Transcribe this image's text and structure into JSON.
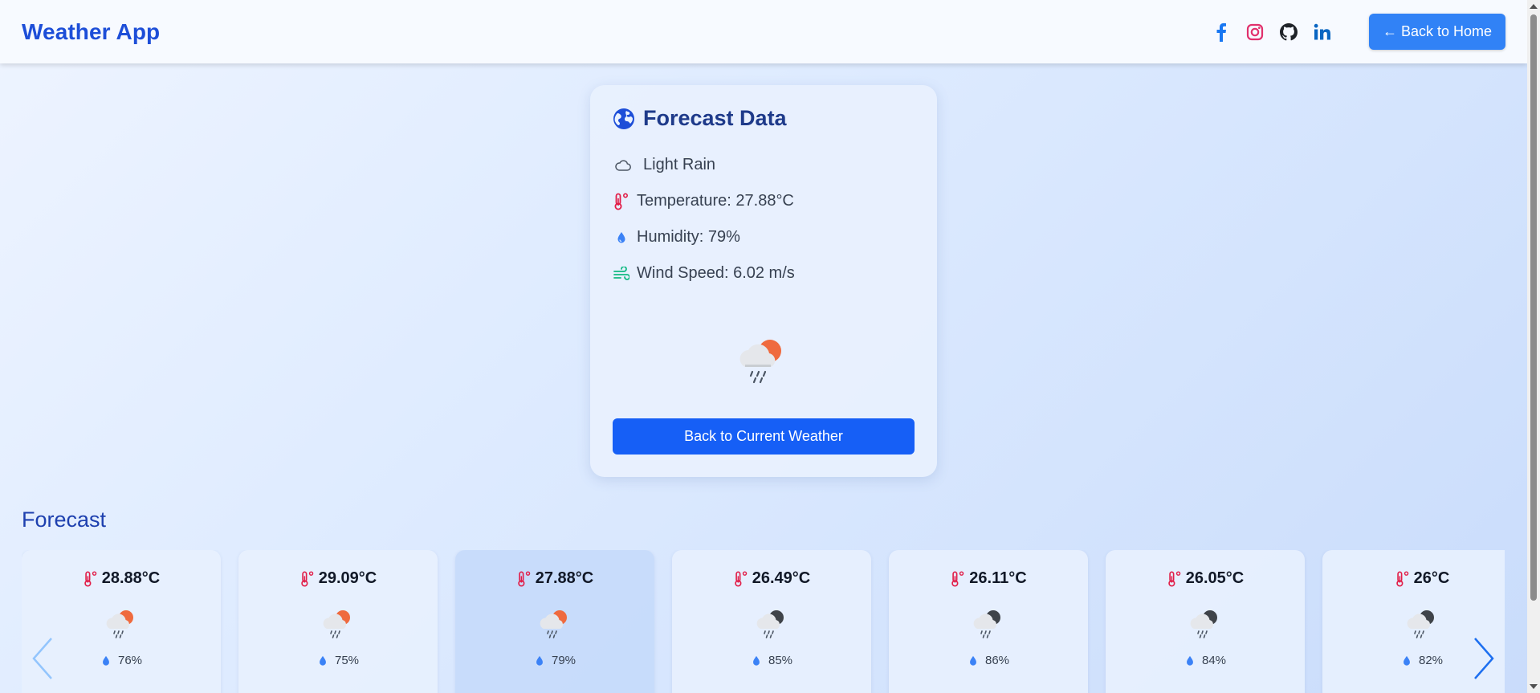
{
  "header": {
    "brand": "Weather App",
    "back_home_label": "← Back to Home",
    "social": [
      "facebook-icon",
      "instagram-icon",
      "github-icon",
      "linkedin-icon"
    ]
  },
  "card": {
    "title": "Forecast Data",
    "condition": "Light Rain",
    "temperature": "Temperature: 27.88°C",
    "humidity": "Humidity: 79%",
    "wind": "Wind Speed: 6.02 m/s",
    "button_label": "Back to Current Weather"
  },
  "forecast": {
    "heading": "Forecast",
    "items": [
      {
        "temp": "28.88°C",
        "humidity": "76%",
        "wind": "",
        "icon": "day-rain-icon",
        "active": false
      },
      {
        "temp": "29.09°C",
        "humidity": "75%",
        "wind": "",
        "icon": "day-rain-icon",
        "active": false
      },
      {
        "temp": "27.88°C",
        "humidity": "79%",
        "wind": "",
        "icon": "day-rain-icon",
        "active": true
      },
      {
        "temp": "26.49°C",
        "humidity": "85%",
        "wind": "",
        "icon": "night-rain-icon",
        "active": false
      },
      {
        "temp": "26.11°C",
        "humidity": "86%",
        "wind": "",
        "icon": "night-rain-icon",
        "active": false
      },
      {
        "temp": "26.05°C",
        "humidity": "84%",
        "wind": "",
        "icon": "night-rain-icon",
        "active": false
      },
      {
        "temp": "26°C",
        "humidity": "82%",
        "wind": "",
        "icon": "night-rain-icon",
        "active": false
      }
    ]
  },
  "colors": {
    "brand": "#1d4ed8",
    "primary_button": "#165ff6",
    "home_button": "#3182f6",
    "thermometer": "#e11d48",
    "drop": "#3b82f6",
    "wind": "#10b981"
  }
}
